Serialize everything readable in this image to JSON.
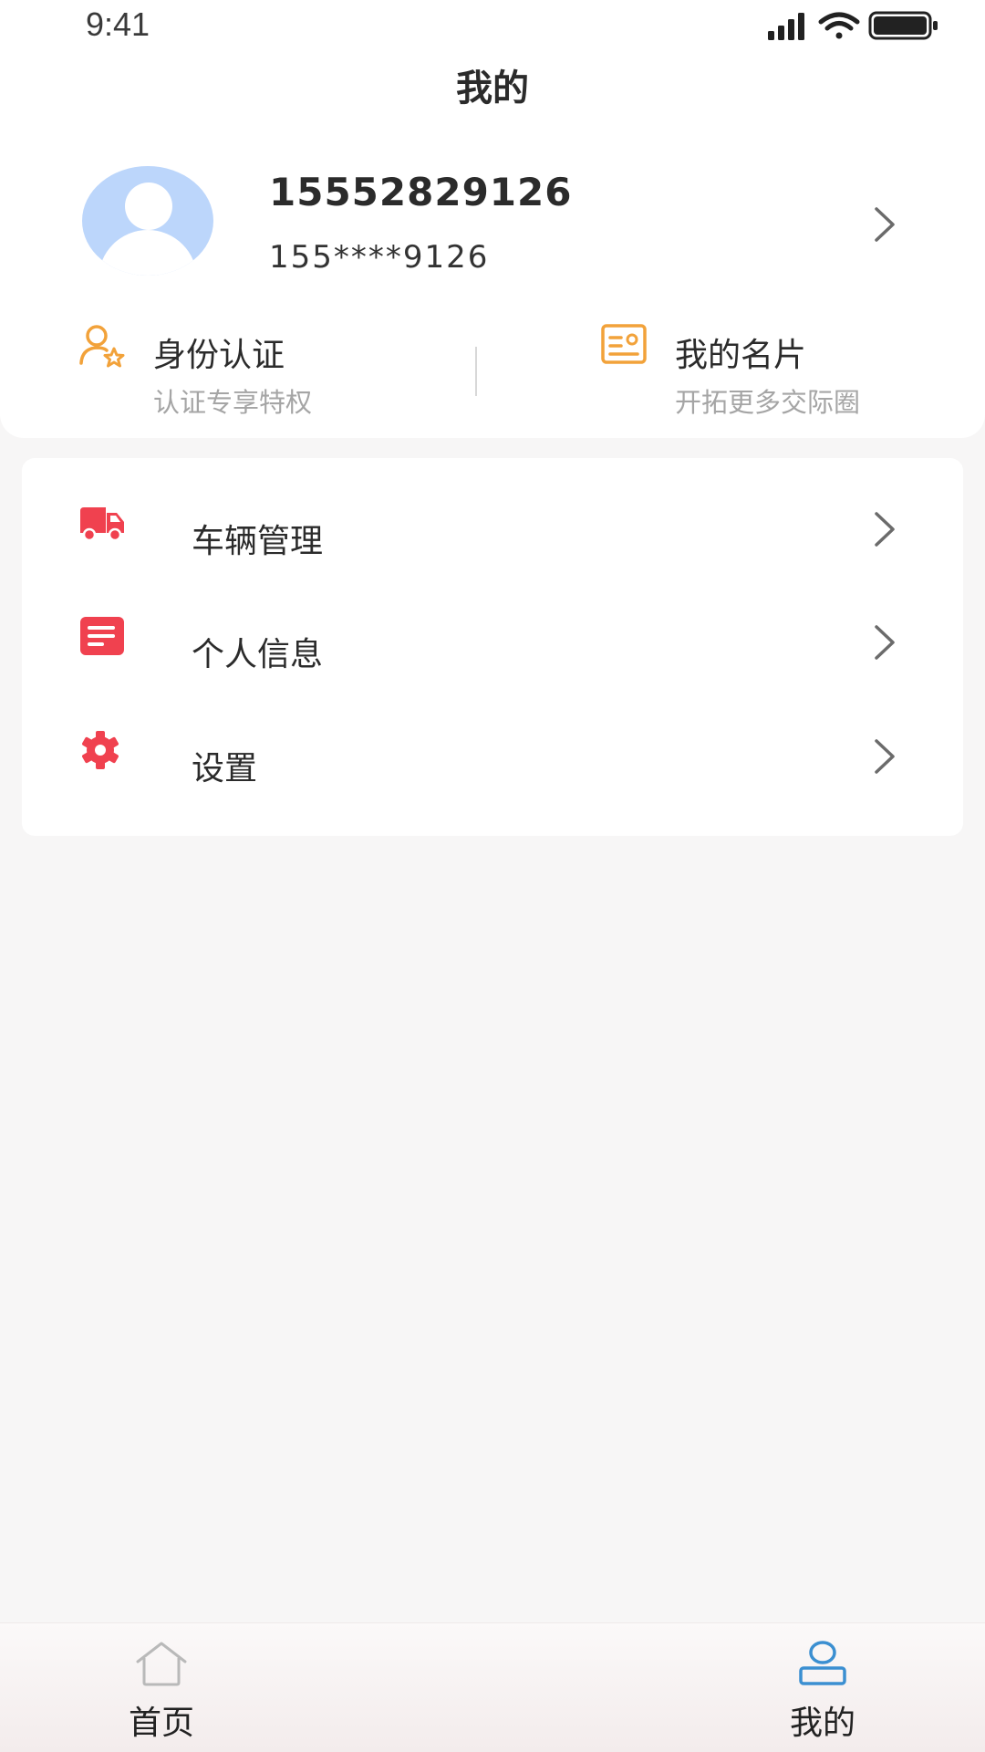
{
  "status_bar": {
    "time": "9:41"
  },
  "header": {
    "title": "我的"
  },
  "profile": {
    "name": "15552829126",
    "phone_masked": "155****9126"
  },
  "quick_actions": [
    {
      "title": "身份认证",
      "subtitle": "认证专享特权",
      "icon": "user-star-icon"
    },
    {
      "title": "我的名片",
      "subtitle": "开拓更多交际圈",
      "icon": "card-icon"
    }
  ],
  "menu": [
    {
      "label": "车辆管理",
      "icon": "truck-icon"
    },
    {
      "label": "个人信息",
      "icon": "document-icon"
    },
    {
      "label": "设置",
      "icon": "gear-icon"
    }
  ],
  "tab_bar": {
    "items": [
      {
        "label": "首页",
        "icon": "home-icon",
        "active": false
      },
      {
        "label": "我的",
        "icon": "person-icon",
        "active": true
      }
    ]
  },
  "colors": {
    "accent_orange": "#f2a23a",
    "menu_icon_red": "#f0414f",
    "avatar_blue": "#bcd6fb",
    "active_tab_blue": "#3b8fd1"
  }
}
